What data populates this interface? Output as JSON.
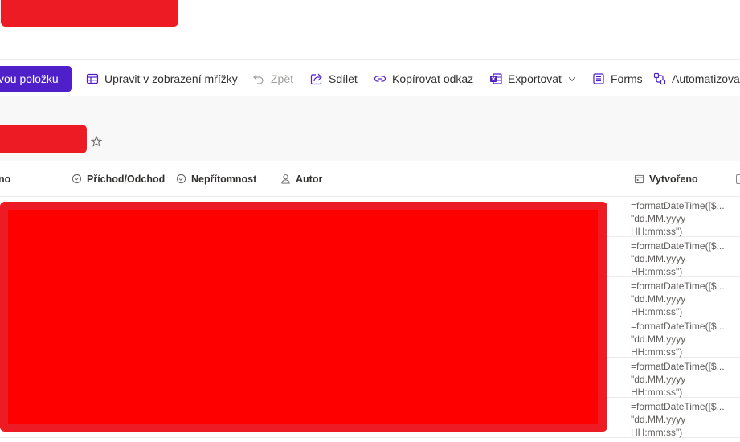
{
  "toolbar": {
    "new_item_label": "vou položku",
    "grid_edit_label": "Upravit v zobrazení mřížky",
    "undo_label": "Zpět",
    "share_label": "Sdílet",
    "copy_link_label": "Kopírovat odkaz",
    "export_label": "Exportovat",
    "forms_label": "Forms",
    "automate_label": "Automatizova"
  },
  "columns": {
    "partial_name": "no",
    "arrival": "Příchod/Odchod",
    "absence": "Nepřítomnost",
    "author": "Autor",
    "created": "Vytvořeno"
  },
  "rows": [
    {
      "created": "=formatDateTime([$...\n\"dd.MM.yyyy\nHH:mm:ss\")"
    },
    {
      "created": "=formatDateTime([$...\n\"dd.MM.yyyy\nHH:mm:ss\")"
    },
    {
      "created": "=formatDateTime([$...\n\"dd.MM.yyyy\nHH:mm:ss\")"
    },
    {
      "created": "=formatDateTime([$...\n\"dd.MM.yyyy\nHH:mm:ss\")"
    },
    {
      "created": "=formatDateTime([$...\n\"dd.MM.yyyy\nHH:mm:ss\")"
    },
    {
      "created": "=formatDateTime([$...\n\"dd.MM.yyyy\nHH:mm:ss\")"
    }
  ],
  "colors": {
    "accent": "#4f1fc9",
    "redaction": "#ed1c24",
    "redaction_inner": "#ff0000"
  },
  "icons": [
    "grid-icon",
    "undo-icon",
    "share-icon",
    "link-icon",
    "excel-icon",
    "chevron-down-icon",
    "forms-icon",
    "automate-icon",
    "star-icon",
    "check-circle-icon",
    "person-icon",
    "calendar-icon"
  ]
}
